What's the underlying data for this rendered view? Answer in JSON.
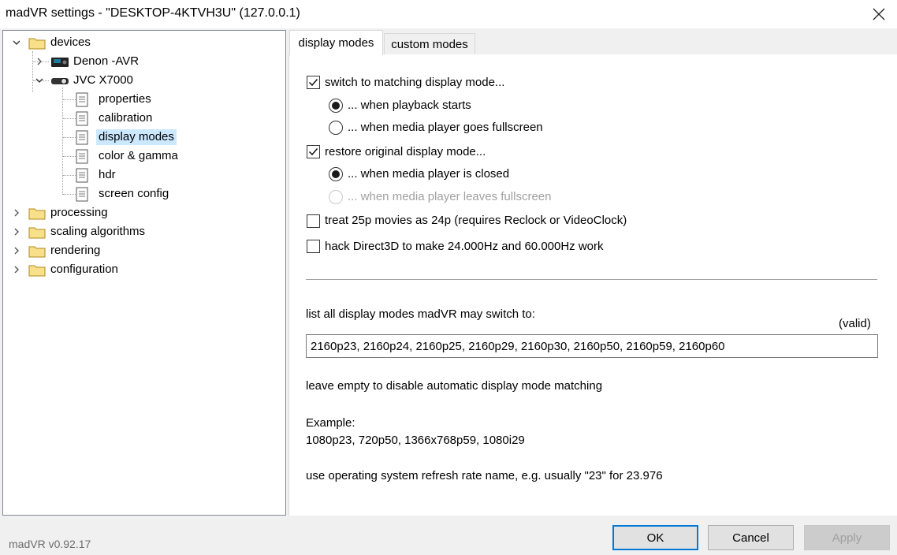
{
  "window": {
    "title": "madVR settings - \"DESKTOP-4KTVH3U\" (127.0.0.1)"
  },
  "tree": {
    "devices": "devices",
    "denon": "Denon -AVR",
    "jvc": "JVC X7000",
    "properties": "properties",
    "calibration": "calibration",
    "display_modes": "display modes",
    "color_gamma": "color & gamma",
    "hdr": "hdr",
    "screen_config": "screen config",
    "processing": "processing",
    "scaling": "scaling algorithms",
    "rendering": "rendering",
    "configuration": "configuration"
  },
  "tabs": {
    "display_modes": "display modes",
    "custom_modes": "custom modes"
  },
  "options": {
    "switch_matching": "switch to matching display mode...",
    "when_playback_starts": "... when playback starts",
    "when_fullscreen": "... when media player goes fullscreen",
    "restore_original": "restore original display mode...",
    "when_closed": "... when media player is closed",
    "when_leaves_fullscreen": "... when media player leaves fullscreen",
    "treat_25p": "treat 25p movies as 24p  (requires Reclock or VideoClock)",
    "hack_d3d": "hack Direct3D to make 24.000Hz and 60.000Hz work"
  },
  "modes": {
    "list_label": "list all display modes madVR may switch to:",
    "valid": "(valid)",
    "value": "2160p23, 2160p24, 2160p25, 2160p29, 2160p30, 2160p50, 2160p59, 2160p60",
    "leave_empty": "leave empty to disable automatic display mode matching",
    "example_label": "Example:",
    "example_value": "1080p23, 720p50, 1366x768p59, 1080i29",
    "hint": "use operating system refresh rate name, e.g. usually \"23\" for 23.976"
  },
  "footer": {
    "version": "madVR v0.92.17",
    "ok": "OK",
    "cancel": "Cancel",
    "apply": "Apply"
  }
}
